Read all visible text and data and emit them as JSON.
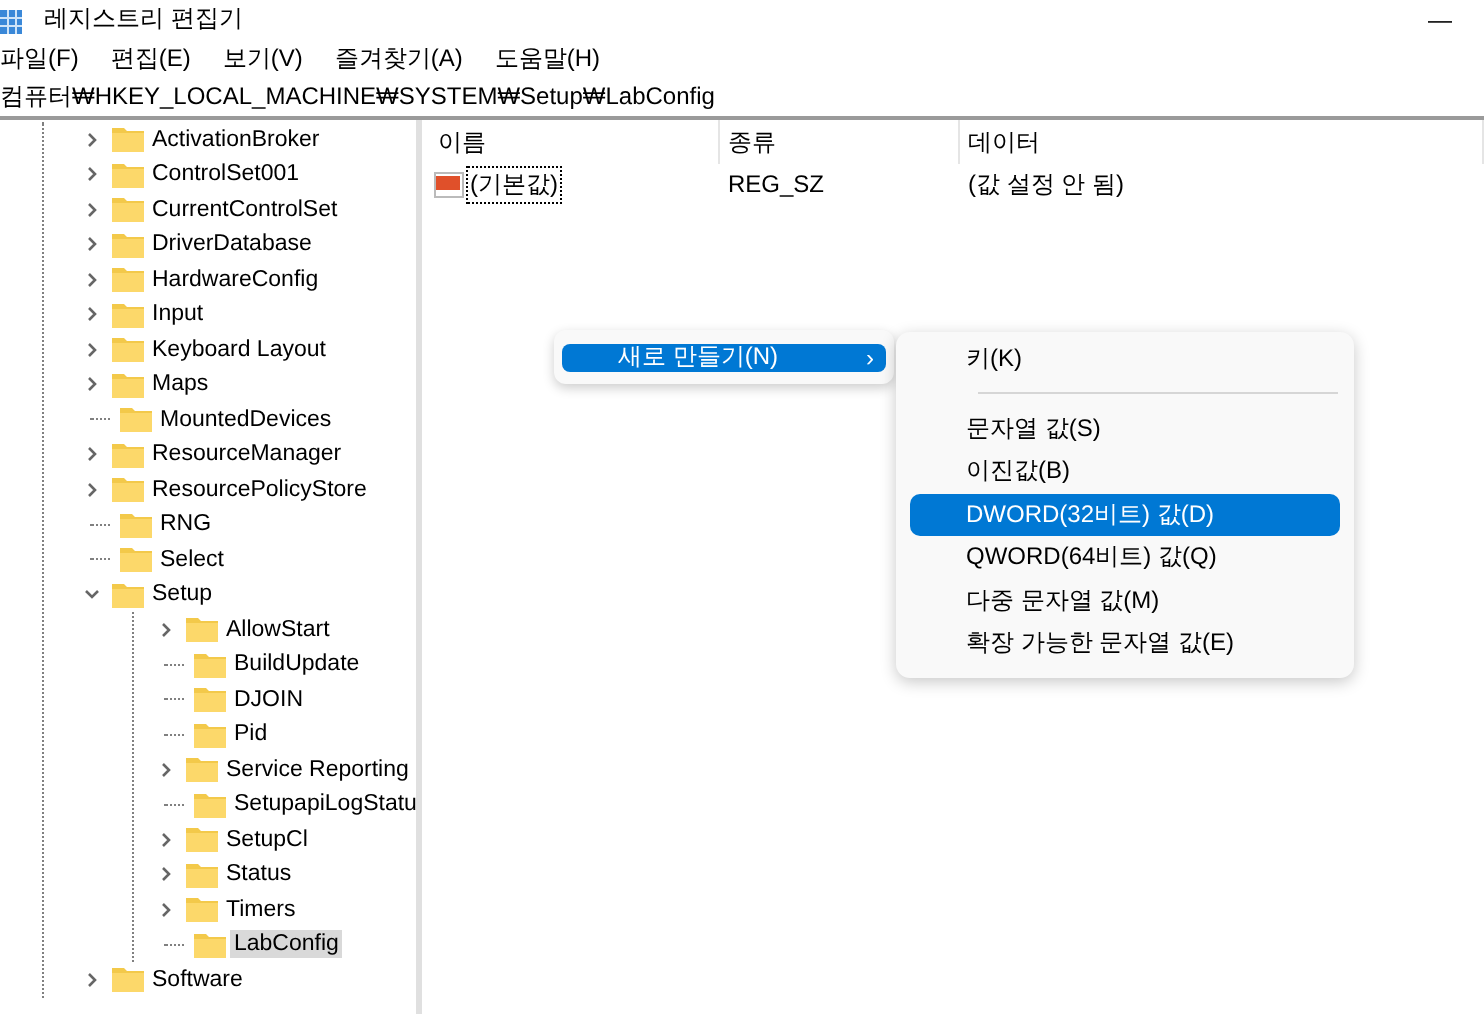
{
  "window": {
    "title": "레지스트리 편집기",
    "minimize": "—"
  },
  "menu": [
    "파일(F)",
    "편집(E)",
    "보기(V)",
    "즐겨찾기(A)",
    "도움말(H)"
  ],
  "address": "컴퓨터₩HKEY_LOCAL_MACHINE₩SYSTEM₩Setup₩LabConfig",
  "tree": [
    {
      "label": "ActivationBroker",
      "kind": "collapsed",
      "selected": false
    },
    {
      "label": "ControlSet001",
      "kind": "collapsed",
      "selected": false
    },
    {
      "label": "CurrentControlSet",
      "kind": "collapsed",
      "selected": false
    },
    {
      "label": "DriverDatabase",
      "kind": "collapsed",
      "selected": false
    },
    {
      "label": "HardwareConfig",
      "kind": "collapsed",
      "selected": false
    },
    {
      "label": "Input",
      "kind": "collapsed",
      "selected": false
    },
    {
      "label": "Keyboard Layout",
      "kind": "collapsed",
      "selected": false
    },
    {
      "label": "Maps",
      "kind": "collapsed",
      "selected": false
    },
    {
      "label": "MountedDevices",
      "kind": "leaf",
      "selected": false
    },
    {
      "label": "ResourceManager",
      "kind": "collapsed",
      "selected": false
    },
    {
      "label": "ResourcePolicyStore",
      "kind": "collapsed",
      "selected": false
    },
    {
      "label": "RNG",
      "kind": "leaf",
      "selected": false
    },
    {
      "label": "Select",
      "kind": "leaf",
      "selected": false
    },
    {
      "label": "Setup",
      "kind": "expanded",
      "selected": false,
      "children": [
        {
          "label": "AllowStart",
          "kind": "collapsed",
          "selected": false
        },
        {
          "label": "BuildUpdate",
          "kind": "leaf",
          "selected": false
        },
        {
          "label": "DJOIN",
          "kind": "leaf",
          "selected": false
        },
        {
          "label": "Pid",
          "kind": "leaf",
          "selected": false
        },
        {
          "label": "Service Reporting",
          "kind": "collapsed",
          "selected": false
        },
        {
          "label": "SetupapiLogStatu",
          "kind": "leaf",
          "selected": false
        },
        {
          "label": "SetupCl",
          "kind": "collapsed",
          "selected": false
        },
        {
          "label": "Status",
          "kind": "collapsed",
          "selected": false
        },
        {
          "label": "Timers",
          "kind": "collapsed",
          "selected": false
        },
        {
          "label": "LabConfig",
          "kind": "leaf",
          "selected": true
        }
      ]
    },
    {
      "label": "Software",
      "kind": "collapsed",
      "selected": false
    }
  ],
  "list": {
    "columns": [
      "이름",
      "종류",
      "데이터"
    ],
    "rows": [
      {
        "name": "(기본값)",
        "type": "REG_SZ",
        "data": "(값 설정 안 됨)",
        "focused": true
      }
    ]
  },
  "context_menu": {
    "items": [
      {
        "label": "새로 만들기(N)",
        "arrow": "›",
        "selected": true
      }
    ]
  },
  "submenu": {
    "items": [
      {
        "kind": "item",
        "label": "키(K)",
        "selected": false
      },
      {
        "kind": "separator"
      },
      {
        "kind": "item",
        "label": "문자열 값(S)",
        "selected": false
      },
      {
        "kind": "item",
        "label": "이진값(B)",
        "selected": false
      },
      {
        "kind": "item",
        "label": "DWORD(32비트) 값(D)",
        "selected": true
      },
      {
        "kind": "item",
        "label": "QWORD(64비트) 값(Q)",
        "selected": false
      },
      {
        "kind": "item",
        "label": "다중 문자열 값(M)",
        "selected": false
      },
      {
        "kind": "item",
        "label": "확장 가능한 문자열 값(E)",
        "selected": false
      }
    ]
  }
}
